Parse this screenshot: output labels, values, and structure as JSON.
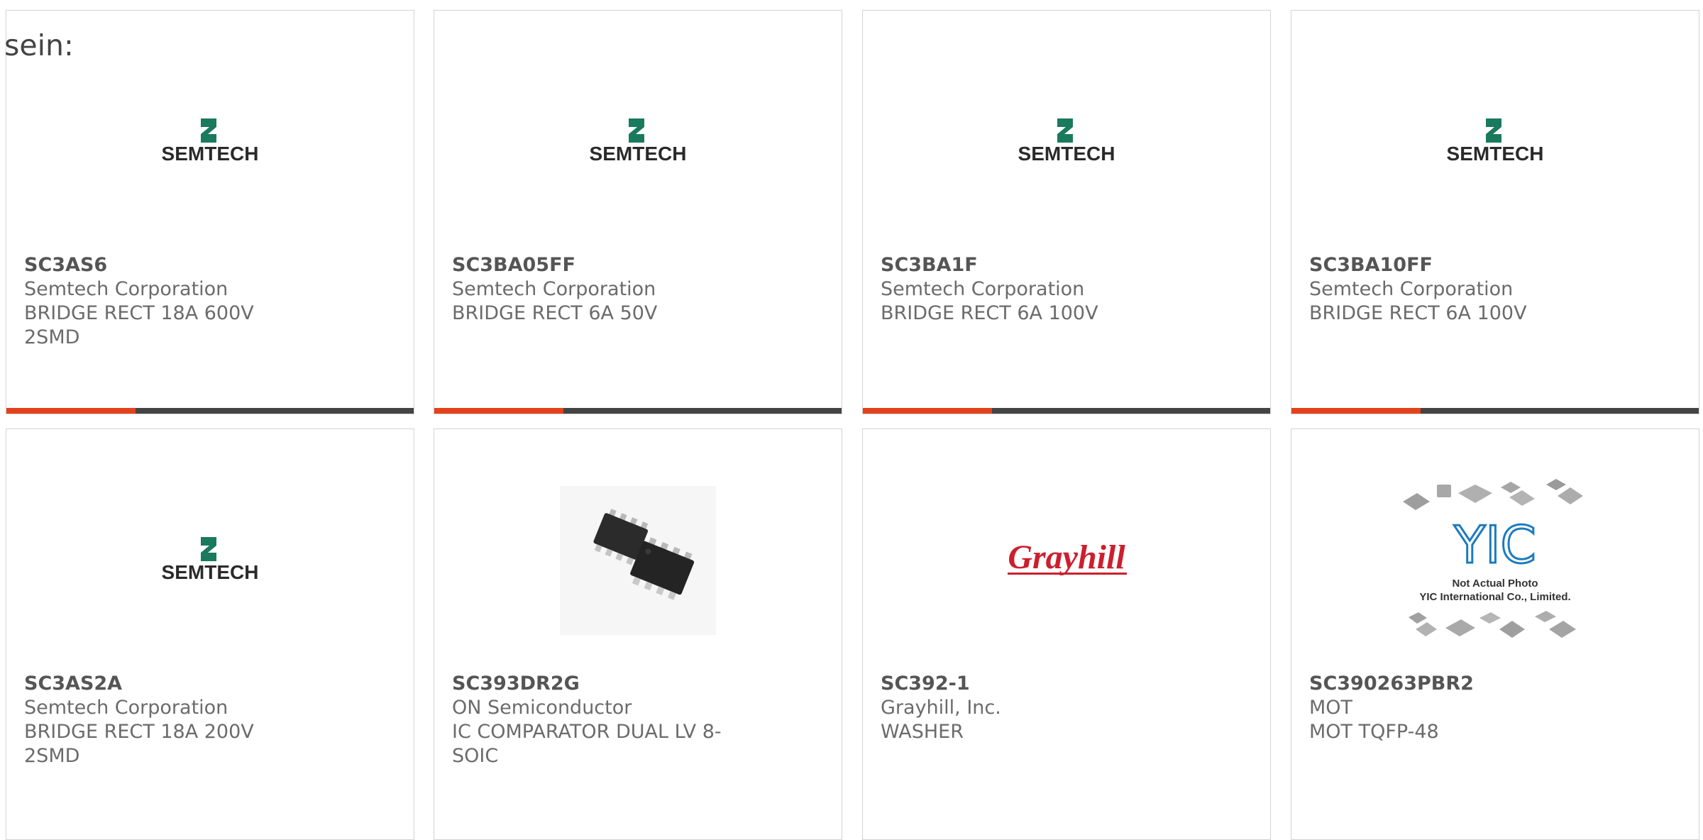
{
  "intro": "sein:",
  "colors": {
    "accent": "#e5411a",
    "bar": "#444444",
    "border": "#d3d3d3",
    "semtech_green": "#1a7a5e",
    "grayhill_red": "#cc1f2e",
    "yic_blue": "#1d7bbd"
  },
  "products": [
    {
      "part": "SC3AS6",
      "manufacturer": "Semtech Corporation",
      "description": "BRIDGE RECT 18A 600V 2SMD",
      "image": "semtech-logo"
    },
    {
      "part": "SC3BA05FF",
      "manufacturer": "Semtech Corporation",
      "description": "BRIDGE RECT 6A 50V",
      "image": "semtech-logo"
    },
    {
      "part": "SC3BA1F",
      "manufacturer": "Semtech Corporation",
      "description": "BRIDGE RECT 6A 100V",
      "image": "semtech-logo"
    },
    {
      "part": "SC3BA10FF",
      "manufacturer": "Semtech Corporation",
      "description": "BRIDGE RECT 6A 100V",
      "image": "semtech-logo"
    },
    {
      "part": "SC3AS2A",
      "manufacturer": "Semtech Corporation",
      "description": "BRIDGE RECT 18A 200V 2SMD",
      "image": "semtech-logo"
    },
    {
      "part": "SC393DR2G",
      "manufacturer": "ON Semiconductor",
      "description": "IC COMPARATOR DUAL LV 8-SOIC",
      "image": "soic-chip-photo"
    },
    {
      "part": "SC392-1",
      "manufacturer": "Grayhill, Inc.",
      "description": "WASHER",
      "image": "grayhill-logo"
    },
    {
      "part": "SC390263PBR2",
      "manufacturer": "MOT",
      "description": "MOT TQFP-48",
      "image": "yic-placeholder"
    }
  ],
  "logos": {
    "semtech": "SEMTECH",
    "grayhill": "Grayhill",
    "yic": "YIC",
    "yic_line1": "Not Actual Photo",
    "yic_line2": "YIC International Co., Limited."
  }
}
